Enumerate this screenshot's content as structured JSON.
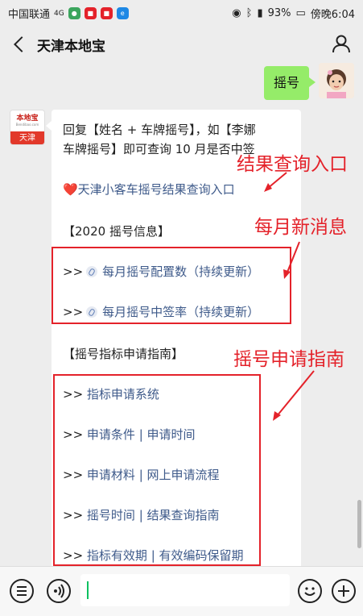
{
  "status_bar": {
    "carrier": "中国联通",
    "network": "4G",
    "battery": "93%",
    "time": "傍晚6:04"
  },
  "header": {
    "title": "天津本地宝"
  },
  "chat": {
    "my_message": "摇号",
    "bot_avatar": {
      "brand_top": "本地宝",
      "brand_sub": "Bendibao.com",
      "city": "天津"
    },
    "reply": {
      "line1": "回复【姓名 + 车牌摇号】，如【李娜",
      "line2": "车牌摇号】即可查询 10 月是否中签",
      "query_link": "❤️天津小客车摇号结果查询入口",
      "section1": "【2020 摇号信息】",
      "info_items": [
        "每月摇号配置数（持续更新）",
        "每月摇号中签率（持续更新）"
      ],
      "section2": "【摇号指标申请指南】",
      "prefix": ">>",
      "guide_items": [
        "指标申请系统",
        "申请条件 | 申请时间",
        "申请材料 | 网上申请流程",
        "摇号时间 | 结果查询指南",
        "指标有效期 | 有效编码保留期"
      ]
    }
  },
  "annotations": {
    "result_query": "结果查询入口",
    "monthly_news": "每月新消息",
    "apply_guide": "摇号申请指南",
    "color": "#e4222a"
  },
  "colors": {
    "my_bubble": "#95ec69",
    "link": "#3e5a8a",
    "background": "#ededed"
  }
}
